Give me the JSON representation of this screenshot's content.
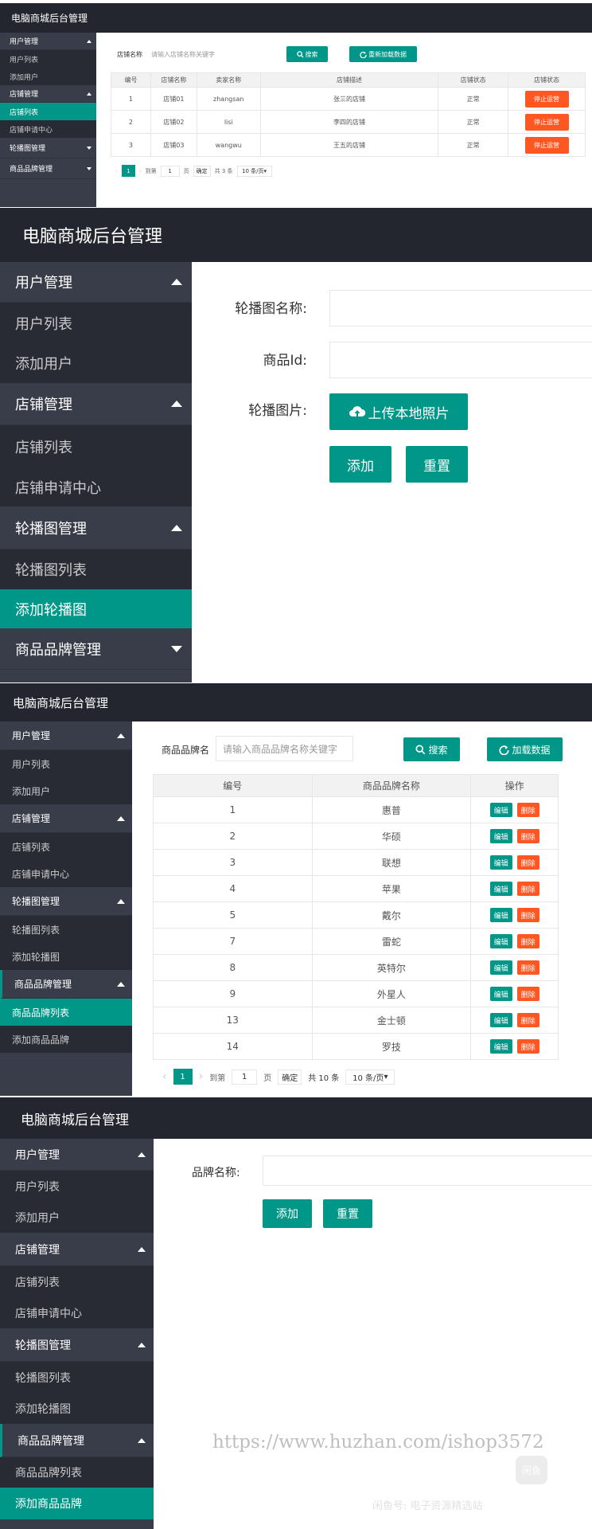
{
  "app_title": "电脑商城后台管理",
  "menu": {
    "user_mgmt": "用户管理",
    "user_list": "用户列表",
    "add_user": "添加用户",
    "shop_mgmt": "店铺管理",
    "shop_list": "店铺列表",
    "shop_apply": "店铺申请中心",
    "carousel_mgmt": "轮播图管理",
    "carousel_list": "轮播图列表",
    "add_carousel": "添加轮播图",
    "brand_mgmt": "商品品牌管理",
    "brand_list": "商品品牌列表",
    "add_brand": "添加商品品牌"
  },
  "shop_list_page": {
    "search_label": "店铺名称",
    "search_placeholder": "请输入店铺名称关键字",
    "search_button": "搜索",
    "reload_button": "重新加载数据",
    "columns": [
      "编号",
      "店铺名称",
      "卖家名称",
      "店铺描述",
      "店铺状态",
      "店铺状态"
    ],
    "rows": [
      {
        "id": "1",
        "name": "店铺01",
        "seller": "zhangsan",
        "desc": "张三的店铺",
        "status": "正常",
        "action": "停止运营"
      },
      {
        "id": "2",
        "name": "店铺02",
        "seller": "lisi",
        "desc": "李四的店铺",
        "status": "正常",
        "action": "停止运营"
      },
      {
        "id": "3",
        "name": "店铺03",
        "seller": "wangwu",
        "desc": "王五的店铺",
        "status": "正常",
        "action": "停止运营"
      }
    ],
    "pager": {
      "current": "1",
      "goto_label": "到第",
      "page_value": "1",
      "page_unit": "页",
      "confirm": "确定",
      "total": "共 3 条",
      "per_page": "10 条/页"
    }
  },
  "add_carousel_page": {
    "name_label": "轮播图名称:",
    "product_id_label": "商品Id:",
    "image_label": "轮播图片:",
    "upload_button": "上传本地照片",
    "add_button": "添加",
    "reset_button": "重置"
  },
  "brand_list_page": {
    "search_label": "商品品牌名",
    "search_placeholder": "请输入商品品牌名称关键字",
    "search_button": "搜索",
    "reload_button": "加载数据",
    "columns": [
      "编号",
      "商品品牌名称",
      "操作"
    ],
    "edit_label": "编辑",
    "delete_label": "删除",
    "rows": [
      {
        "id": "1",
        "name": "惠普"
      },
      {
        "id": "2",
        "name": "华硕"
      },
      {
        "id": "3",
        "name": "联想"
      },
      {
        "id": "4",
        "name": "苹果"
      },
      {
        "id": "5",
        "name": "戴尔"
      },
      {
        "id": "7",
        "name": "雷蛇"
      },
      {
        "id": "8",
        "name": "英特尔"
      },
      {
        "id": "9",
        "name": "外星人"
      },
      {
        "id": "13",
        "name": "金士顿"
      },
      {
        "id": "14",
        "name": "罗技"
      }
    ],
    "pager": {
      "current": "1",
      "goto_label": "到第",
      "page_value": "1",
      "page_unit": "页",
      "confirm": "确定",
      "total": "共 10 条",
      "per_page": "10 条/页"
    }
  },
  "add_brand_page": {
    "name_label": "品牌名称:",
    "add_button": "添加",
    "reset_button": "重置"
  },
  "watermark": {
    "url": "https://www.huzhan.com/ishop3572",
    "logo": "闲鱼",
    "tagline": "闲鱼号: 电子资源精选站"
  },
  "colors": {
    "header": "#23262e",
    "sidebar": "#393d49",
    "submenu": "#282b33",
    "accent": "#009688",
    "danger": "#ff5722"
  }
}
